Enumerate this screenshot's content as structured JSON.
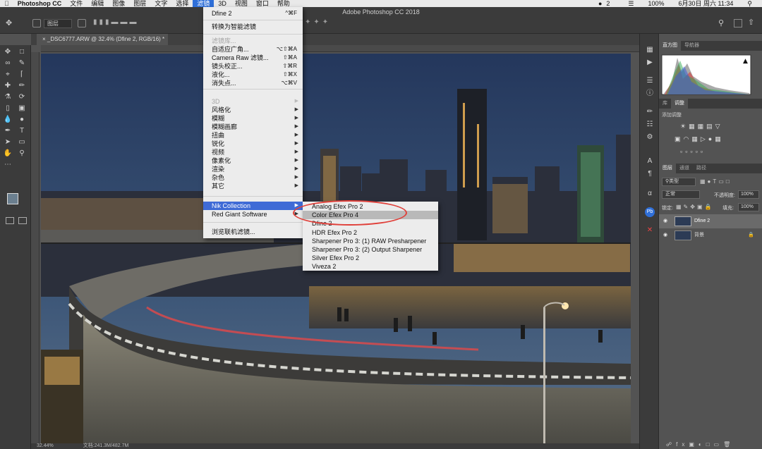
{
  "macbar": {
    "apple": "",
    "app_name": "Photoshop CC",
    "menus": [
      "文件",
      "编辑",
      "图像",
      "图层",
      "文字",
      "选择",
      "滤镜",
      "3D",
      "视图",
      "窗口",
      "帮助"
    ],
    "active_menu": "滤镜",
    "status_right": {
      "user_count": "2",
      "battery": "100%",
      "datetime": "6月30日 周六 11:34"
    }
  },
  "window": {
    "title": "Adobe Photoshop CC 2018"
  },
  "options_bar": {
    "layer_select": "图层"
  },
  "document": {
    "tab_title": "_DSC6777.ARW @ 32.4% (Dfine 2, RGB/16) *",
    "status_zoom": "32.44%",
    "status_doc": "文档:241.3M/482.7M"
  },
  "filter_menu": {
    "items": [
      {
        "label": "Dfine 2",
        "shortcut": "^⌘F",
        "disabled": false,
        "submenu": false
      },
      {
        "label": "转换为智能滤镜",
        "shortcut": "",
        "disabled": false,
        "submenu": false
      },
      {
        "label": "滤镜库...",
        "shortcut": "",
        "disabled": true,
        "submenu": false
      },
      {
        "label": "自适应广角...",
        "shortcut": "⌥⇧⌘A",
        "disabled": false,
        "submenu": false
      },
      {
        "label": "Camera Raw 滤镜...",
        "shortcut": "⇧⌘A",
        "disabled": false,
        "submenu": false
      },
      {
        "label": "镜头校正...",
        "shortcut": "⇧⌘R",
        "disabled": false,
        "submenu": false
      },
      {
        "label": "液化...",
        "shortcut": "⇧⌘X",
        "disabled": false,
        "submenu": false
      },
      {
        "label": "消失点...",
        "shortcut": "⌥⌘V",
        "disabled": false,
        "submenu": false
      },
      {
        "label": "3D",
        "shortcut": "",
        "disabled": true,
        "submenu": true
      },
      {
        "label": "风格化",
        "shortcut": "",
        "disabled": false,
        "submenu": true
      },
      {
        "label": "模糊",
        "shortcut": "",
        "disabled": false,
        "submenu": true
      },
      {
        "label": "模糊画廊",
        "shortcut": "",
        "disabled": false,
        "submenu": true
      },
      {
        "label": "扭曲",
        "shortcut": "",
        "disabled": false,
        "submenu": true
      },
      {
        "label": "锐化",
        "shortcut": "",
        "disabled": false,
        "submenu": true
      },
      {
        "label": "视频",
        "shortcut": "",
        "disabled": false,
        "submenu": true
      },
      {
        "label": "像素化",
        "shortcut": "",
        "disabled": false,
        "submenu": true
      },
      {
        "label": "渲染",
        "shortcut": "",
        "disabled": false,
        "submenu": true
      },
      {
        "label": "杂色",
        "shortcut": "",
        "disabled": false,
        "submenu": true
      },
      {
        "label": "其它",
        "shortcut": "",
        "disabled": false,
        "submenu": true
      },
      {
        "label": "Nik Collection",
        "shortcut": "",
        "disabled": false,
        "submenu": true,
        "highlighted": true
      },
      {
        "label": "Red Giant Software",
        "shortcut": "",
        "disabled": false,
        "submenu": true
      },
      {
        "label": "浏览联机滤镜...",
        "shortcut": "",
        "disabled": false,
        "submenu": false
      }
    ]
  },
  "nik_submenu": {
    "items": [
      "Analog Efex Pro 2",
      "Color Efex Pro 4",
      "Dfine 2",
      "HDR Efex Pro 2",
      "Sharpener Pro 3: (1) RAW Presharpener",
      "Sharpener Pro 3: (2) Output Sharpener",
      "Silver Efex Pro 2",
      "Viveza 2"
    ],
    "highlighted": "Color Efex Pro 4"
  },
  "panels": {
    "histogram_tabs": [
      "直方图",
      "导航器"
    ],
    "adjust_tabs": [
      "库",
      "调整"
    ],
    "adjust_title": "添加调整",
    "layers_tabs": [
      "图层",
      "通道",
      "路径"
    ],
    "kind_select": "类型",
    "blend_mode": "正常",
    "opacity_label": "不透明度:",
    "opacity_value": "100%",
    "lock_label": "锁定:",
    "fill_label": "填充:",
    "fill_value": "100%",
    "layers": [
      {
        "name": "Dfine 2",
        "selected": true
      },
      {
        "name": "背景",
        "selected": false
      }
    ]
  },
  "colors": {
    "menu_highlight": "#3f6bd6",
    "annotation_circle": "#e0403a"
  }
}
